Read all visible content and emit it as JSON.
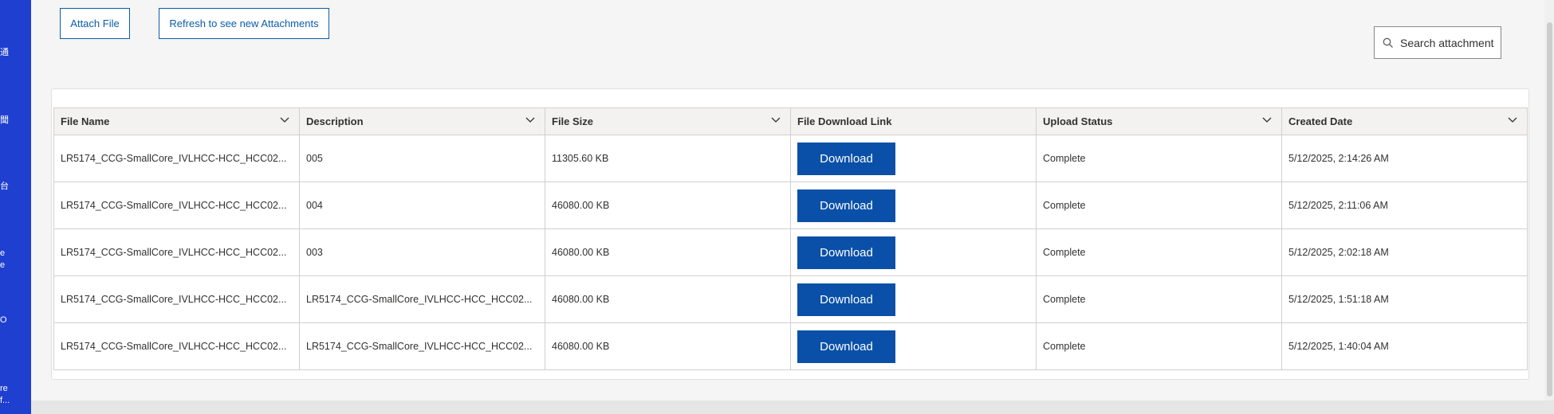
{
  "left_strip": {
    "fragments": [
      "通",
      "聞",
      "台",
      "e",
      "e",
      "O",
      "re",
      "f..."
    ]
  },
  "toolbar": {
    "attach_label": "Attach File",
    "refresh_label": "Refresh to see new Attachments"
  },
  "search": {
    "placeholder": "Search attachments",
    "icon": "search-icon"
  },
  "table": {
    "columns": [
      "File Name",
      "Description",
      "File Size",
      "File Download Link",
      "Upload Status",
      "Created Date"
    ],
    "download_label": "Download",
    "rows": [
      {
        "file_name": "LR5174_CCG-SmallCore_IVLHCC-HCC_HCC02...",
        "description": "005",
        "size": "11305.60 KB",
        "status": "Complete",
        "created": "5/12/2025, 2:14:26 AM"
      },
      {
        "file_name": "LR5174_CCG-SmallCore_IVLHCC-HCC_HCC02...",
        "description": "004",
        "size": "46080.00 KB",
        "status": "Complete",
        "created": "5/12/2025, 2:11:06 AM"
      },
      {
        "file_name": "LR5174_CCG-SmallCore_IVLHCC-HCC_HCC02...",
        "description": "003",
        "size": "46080.00 KB",
        "status": "Complete",
        "created": "5/12/2025, 2:02:18 AM"
      },
      {
        "file_name": "LR5174_CCG-SmallCore_IVLHCC-HCC_HCC02...",
        "description": "LR5174_CCG-SmallCore_IVLHCC-HCC_HCC02...",
        "size": "46080.00 KB",
        "status": "Complete",
        "created": "5/12/2025, 1:51:18 AM"
      },
      {
        "file_name": "LR5174_CCG-SmallCore_IVLHCC-HCC_HCC02...",
        "description": "LR5174_CCG-SmallCore_IVLHCC-HCC_HCC02...",
        "size": "46080.00 KB",
        "status": "Complete",
        "created": "5/12/2025, 1:40:04 AM"
      }
    ]
  },
  "colors": {
    "accent": "#0b5cab",
    "download_button": "#0a50a8",
    "left_strip": "#1f3fd1"
  }
}
